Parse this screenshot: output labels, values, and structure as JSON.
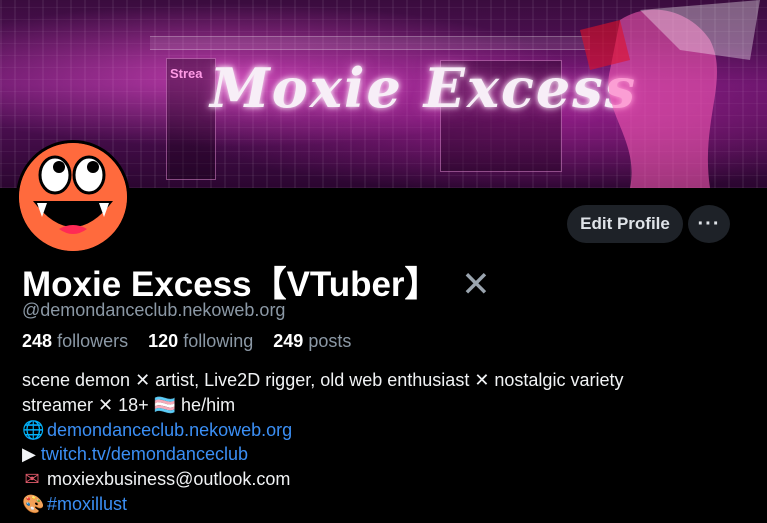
{
  "profile": {
    "name": "Moxie Excess【VTuber】",
    "name_icon": "✕",
    "handle": "@demondanceclub.nekoweb.org",
    "edit_label": "Edit Profile",
    "more_label": "···"
  },
  "banner": {
    "logo_text": "Moxie Excess",
    "side_label": "Strea"
  },
  "stats": {
    "followers_count": "248",
    "followers_label": "followers",
    "following_count": "120",
    "following_label": "following",
    "posts_count": "249",
    "posts_label": "posts"
  },
  "bio": {
    "line1": "scene demon ✕ artist, Live2D rigger, old web enthusiast ✕ nostalgic variety",
    "line2": "streamer ✕ 18+ 🏳️‍⚧️ he/him",
    "website_icon": "🌐",
    "website": "demondanceclub.nekoweb.org",
    "twitch_icon": "▶",
    "twitch": "twitch.tv/demondanceclub",
    "email_icon": "✉",
    "email": "moxiexbusiness@outlook.com",
    "tag_icon": "🎨",
    "tag": "#moxillust"
  },
  "colors": {
    "link": "#3b8ff5",
    "muted": "#8b98a5",
    "button_bg": "#1e2228",
    "avatar": "#ff6a3d"
  },
  "icons": {
    "more": "more-dots-icon",
    "x_mark": "x-mark-icon",
    "globe": "globe-icon",
    "play": "play-icon",
    "mail": "mail-icon",
    "palette": "palette-icon"
  }
}
